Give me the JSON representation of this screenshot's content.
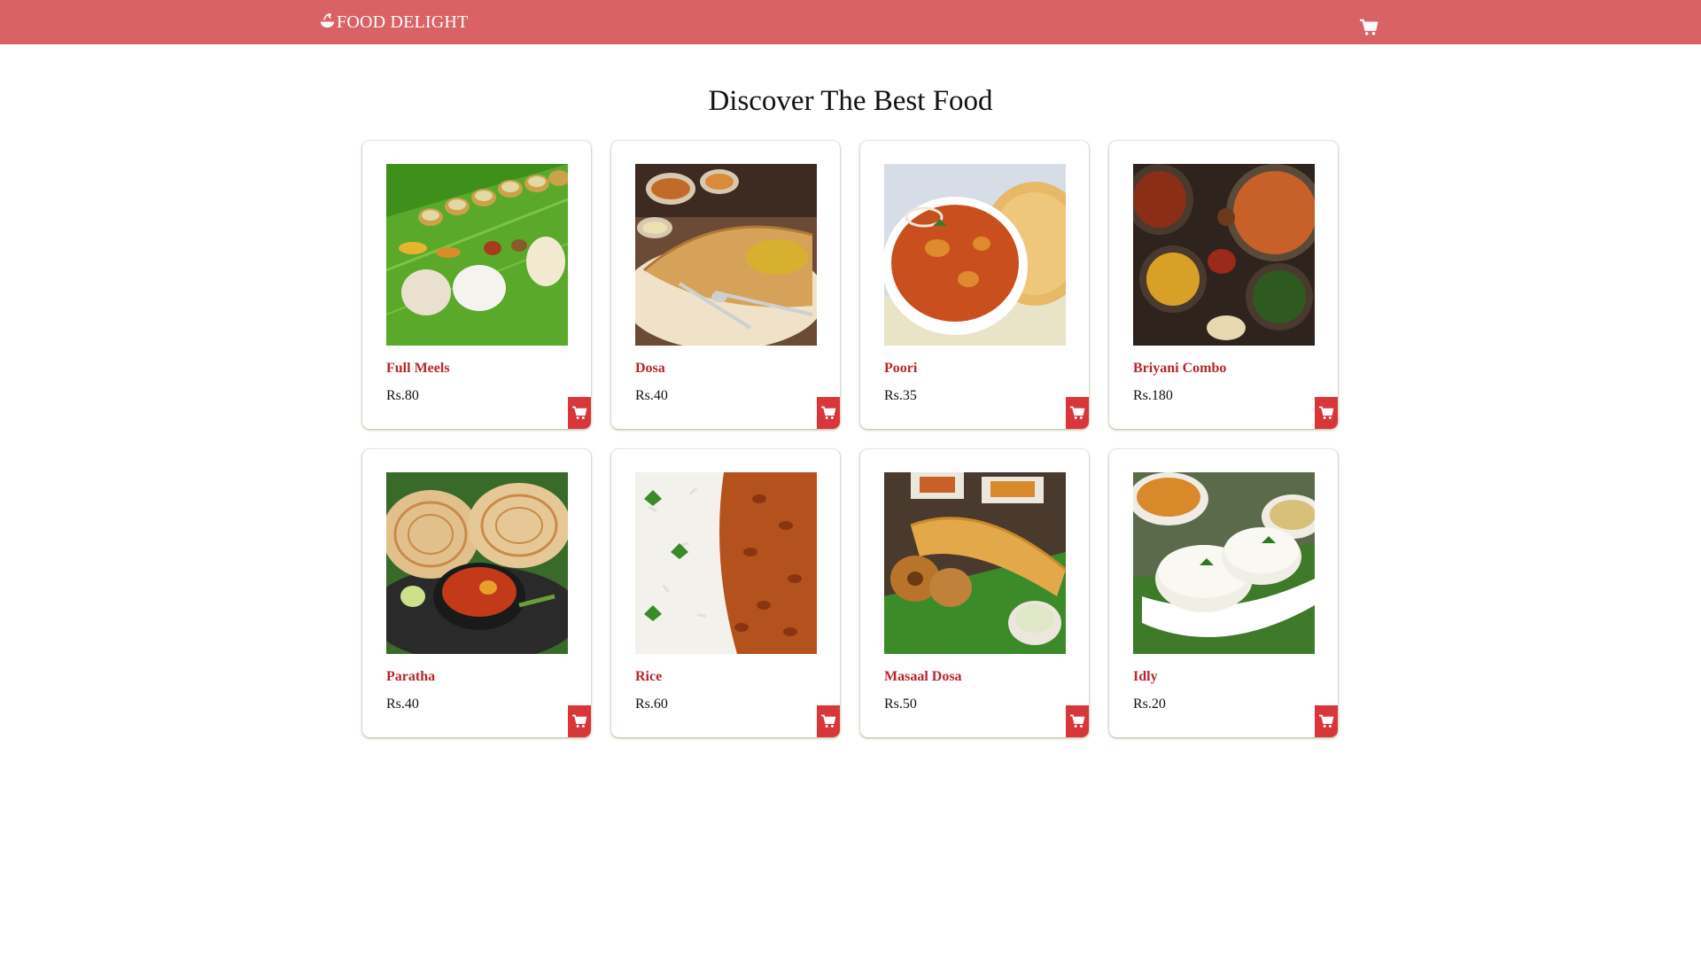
{
  "header": {
    "brand": "FOOD DELIGHT",
    "brand_icon": "food-bowl-icon",
    "cart_icon": "shopping-cart-icon",
    "background_color": "#d96265"
  },
  "main": {
    "heading": "Discover The Best Food",
    "items": [
      {
        "name": "Full Meels",
        "price": "Rs.80",
        "image": "banana-leaf-meals"
      },
      {
        "name": "Dosa",
        "price": "Rs.40",
        "image": "dosa-with-chutney"
      },
      {
        "name": "Poori",
        "price": "Rs.35",
        "image": "poori-with-curry"
      },
      {
        "name": "Briyani Combo",
        "price": "Rs.180",
        "image": "biryani-spread"
      },
      {
        "name": "Paratha",
        "price": "Rs.40",
        "image": "paratha-with-curry"
      },
      {
        "name": "Rice",
        "price": "Rs.60",
        "image": "rice-and-rajma"
      },
      {
        "name": "Masaal Dosa",
        "price": "Rs.50",
        "image": "masala-dosa-vada"
      },
      {
        "name": "Idly",
        "price": "Rs.20",
        "image": "idly-plate"
      }
    ],
    "accent_color": "#d9363a",
    "name_color": "#b8262b"
  }
}
